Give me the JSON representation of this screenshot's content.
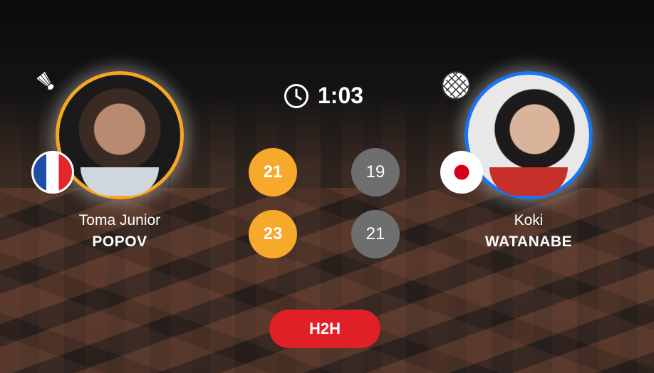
{
  "match": {
    "duration": "1:03"
  },
  "players": {
    "left": {
      "first_name": "Toma Junior",
      "last_name": "POPOV",
      "flag": "france-flag",
      "accent_color": "#f5a623",
      "serve_icon": "shuttlecock-icon"
    },
    "right": {
      "first_name": "Koki",
      "last_name": "WATANABE",
      "flag": "japan-flag",
      "accent_color": "#1976f0",
      "serve_icon": "racket-icon"
    }
  },
  "games": [
    {
      "left": "21",
      "right": "19",
      "winner": "left"
    },
    {
      "left": "23",
      "right": "21",
      "winner": "left"
    }
  ],
  "actions": {
    "h2h_label": "H2H"
  },
  "colors": {
    "winner_score": "#f7a92b",
    "loser_score": "#6e6e6e",
    "h2h_button": "#e11f26"
  }
}
